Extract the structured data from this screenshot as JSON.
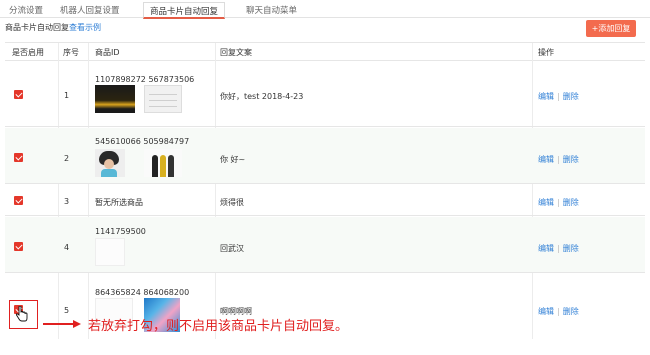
{
  "tabs": [
    "分流设置",
    "机器人回复设置",
    "商品卡片自动回复",
    "聊天自动菜单"
  ],
  "active_tab": 2,
  "subbar": {
    "title": "商品卡片自动回复",
    "link": "查看示例"
  },
  "add_button": "+添加回复",
  "columns": [
    "是否启用",
    "序号",
    "商品ID",
    "回复文案",
    "操作"
  ],
  "rows": [
    {
      "seq": "1",
      "ids": "1107898272 567873506",
      "reply": "你好，test 2018-4-23",
      "edit": "编辑",
      "delete": "删除",
      "checked": true
    },
    {
      "seq": "2",
      "ids": "545610066 505984797",
      "reply": "你 好~",
      "edit": "编辑",
      "delete": "删除",
      "checked": true
    },
    {
      "seq": "3",
      "ids": "暂无所选商品",
      "reply": "烦得很",
      "edit": "编辑",
      "delete": "删除",
      "checked": true
    },
    {
      "seq": "4",
      "ids": "1141759500",
      "reply": "回武汉",
      "edit": "编辑",
      "delete": "删除",
      "checked": true
    },
    {
      "seq": "5",
      "ids": "864365824 864068200",
      "reply": "啊啊啊啊",
      "edit": "编辑",
      "delete": "删除",
      "checked": true
    }
  ],
  "annotation": "若放弃打勾，则不启用该商品卡片自动回复。",
  "colors": {
    "accent": "#e4372a",
    "link": "#2f7fd6",
    "add_button": "#f36b4e",
    "annotation": "#e02020"
  }
}
